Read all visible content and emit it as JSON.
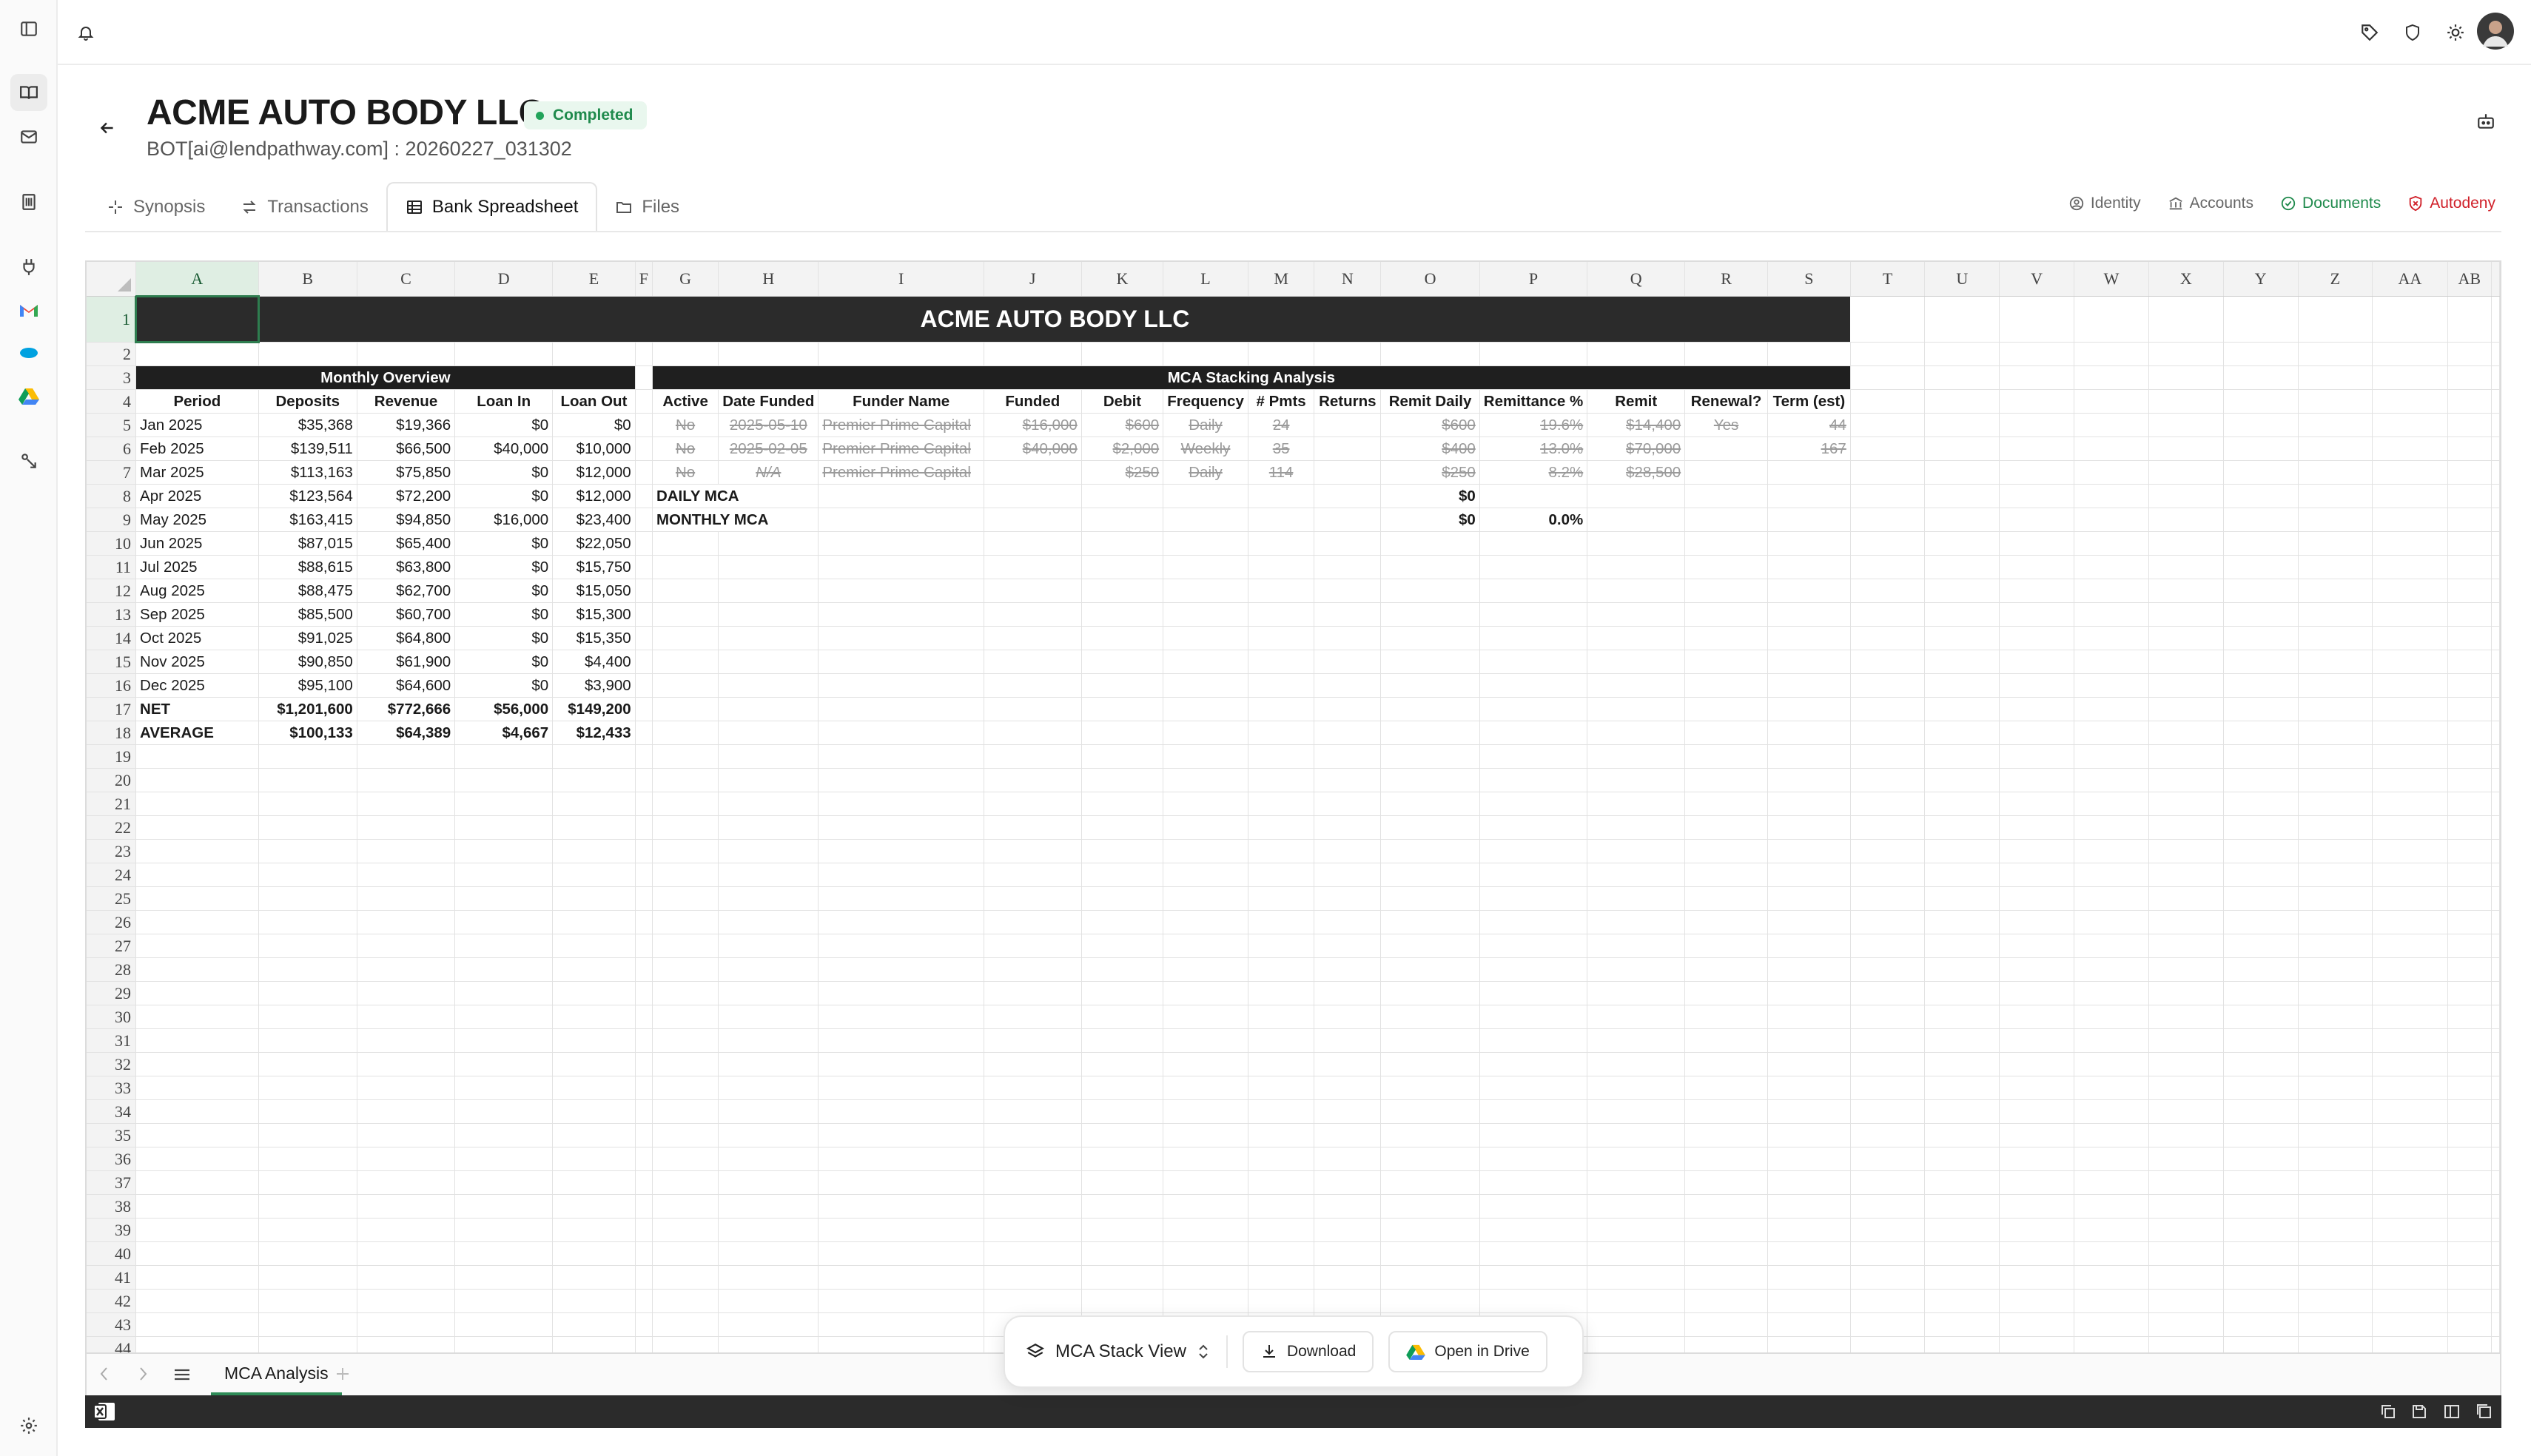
{
  "app": {
    "company": "ACME AUTO BODY LLC",
    "status": "Completed",
    "subtitle": "BOT[ai@lendpathway.com] : 20260227_031302"
  },
  "tabs": [
    {
      "label": "Synopsis",
      "icon": "sparkle-icon"
    },
    {
      "label": "Transactions",
      "icon": "arrows-icon"
    },
    {
      "label": "Bank Spreadsheet",
      "icon": "table-icon",
      "active": true
    },
    {
      "label": "Files",
      "icon": "folder-icon"
    }
  ],
  "right_links": {
    "identity": "Identity",
    "accounts": "Accounts",
    "documents": "Documents",
    "autodeny": "Autodeny"
  },
  "colors": {
    "accent_green": "#2e8b57",
    "status_green": "#1f8a4c",
    "autodeny_red": "#d0212a",
    "banner_dark": "#2b2b2b"
  },
  "sheet": {
    "columns": [
      "A",
      "B",
      "C",
      "D",
      "E",
      "F",
      "G",
      "H",
      "I",
      "J",
      "K",
      "L",
      "M",
      "N",
      "O",
      "P",
      "Q",
      "R",
      "S",
      "T",
      "U",
      "V",
      "W",
      "X",
      "Y",
      "Z",
      "AA",
      "AB"
    ],
    "banner": "ACME AUTO BODY LLC",
    "monthly_overview": {
      "title": "Monthly Overview",
      "headers": [
        "Period",
        "Deposits",
        "Revenue",
        "Loan In",
        "Loan Out"
      ],
      "rows": [
        [
          "Jan 2025",
          "$35,368",
          "$19,366",
          "$0",
          "$0"
        ],
        [
          "Feb 2025",
          "$139,511",
          "$66,500",
          "$40,000",
          "$10,000"
        ],
        [
          "Mar 2025",
          "$113,163",
          "$75,850",
          "$0",
          "$12,000"
        ],
        [
          "Apr 2025",
          "$123,564",
          "$72,200",
          "$0",
          "$12,000"
        ],
        [
          "May 2025",
          "$163,415",
          "$94,850",
          "$16,000",
          "$23,400"
        ],
        [
          "Jun 2025",
          "$87,015",
          "$65,400",
          "$0",
          "$22,050"
        ],
        [
          "Jul 2025",
          "$88,615",
          "$63,800",
          "$0",
          "$15,750"
        ],
        [
          "Aug 2025",
          "$88,475",
          "$62,700",
          "$0",
          "$15,050"
        ],
        [
          "Sep 2025",
          "$85,500",
          "$60,700",
          "$0",
          "$15,300"
        ],
        [
          "Oct 2025",
          "$91,025",
          "$64,800",
          "$0",
          "$15,350"
        ],
        [
          "Nov 2025",
          "$90,850",
          "$61,900",
          "$0",
          "$4,400"
        ],
        [
          "Dec 2025",
          "$95,100",
          "$64,600",
          "$0",
          "$3,900"
        ]
      ],
      "net": [
        "NET",
        "$1,201,600",
        "$772,666",
        "$56,000",
        "$149,200"
      ],
      "average": [
        "AVERAGE",
        "$100,133",
        "$64,389",
        "$4,667",
        "$12,433"
      ]
    },
    "mca": {
      "title": "MCA Stacking Analysis",
      "headers": [
        "Active",
        "Date Funded",
        "Funder Name",
        "Funded",
        "Debit",
        "Frequency",
        "# Pmts",
        "Returns",
        "Remit Daily",
        "Remittance %",
        "Remit",
        "Renewal?",
        "Term (est)"
      ],
      "rows": [
        [
          "No",
          "2025-05-10",
          "Premier Prime Capital",
          "$16,000",
          "$600",
          "Daily",
          "24",
          "",
          "$600",
          "19.6%",
          "$14,400",
          "Yes",
          "44"
        ],
        [
          "No",
          "2025-02-05",
          "Premier Prime Capital",
          "$40,000",
          "$2,000",
          "Weekly",
          "35",
          "",
          "$400",
          "13.0%",
          "$70,000",
          "",
          "167"
        ],
        [
          "No",
          "N/A",
          "Premier Prime Capital",
          "",
          "$250",
          "Daily",
          "114",
          "",
          "$250",
          "8.2%",
          "$28,500",
          "",
          ""
        ]
      ],
      "daily_label": "DAILY MCA",
      "daily_value": "$0",
      "monthly_label": "MONTHLY MCA",
      "monthly_value": "$0",
      "monthly_pct": "0.0%"
    },
    "sheet_tab": "MCA Analysis",
    "row_count": 44
  },
  "floatbar": {
    "view": "MCA Stack View",
    "download": "Download",
    "open_drive": "Open in Drive"
  }
}
